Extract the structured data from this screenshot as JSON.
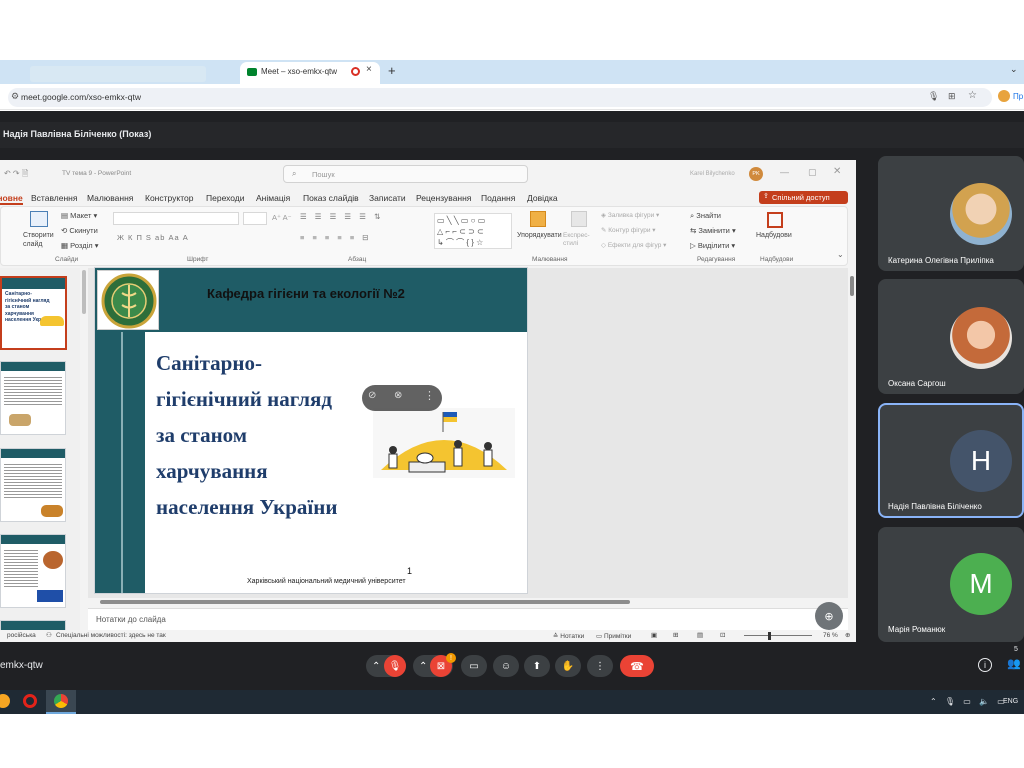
{
  "browser": {
    "tab_title": "Meet – xso-emkx-qtw",
    "url": "meet.google.com/xso-emkx-qtw",
    "profile_label": "Пр"
  },
  "meet": {
    "presenter_banner": "Надія Павлівна Біліченко (Показ)",
    "meeting_code": "emkx-qtw",
    "participants_count": "5",
    "mic_badge": "!"
  },
  "powerpoint": {
    "title": "ТV тема 9 - PowerPoint",
    "search_placeholder": "Пошук",
    "user_name": "Karel Bilychenko",
    "user_initials": "PK",
    "share_button": "Спільний доступ",
    "tabs": [
      "Основне",
      "Вставлення",
      "Малювання",
      "Конструктор",
      "Переходи",
      "Анімація",
      "Показ слайдів",
      "Записати",
      "Рецензування",
      "Подання",
      "Довідка"
    ],
    "ribbon": {
      "create_slide": "Створити слайд",
      "layout": "Макет",
      "reset": "Скинути",
      "section": "Розділ",
      "arrange": "Упорядкувати",
      "quick_styles": "Експрес-стилі",
      "shape_fill": "Заливка фігури",
      "shape_outline": "Контур фігури",
      "shape_effects": "Ефекти для фігур",
      "find": "Знайти",
      "replace": "Замінити",
      "select": "Виділити",
      "addins": "Надбудови",
      "font_row": "Ж  К  П  S  ab  Аа  А",
      "groups": [
        "Слайди",
        "Шрифт",
        "Абзац",
        "Малювання",
        "Редагування",
        "Надбудови"
      ]
    },
    "slide": {
      "header": "Кафедра гігієни та екології №2",
      "title_lines": [
        "Санітарно-",
        "гігієнічний нагляд",
        "за станом",
        "харчування",
        "населення України"
      ],
      "number": "1",
      "footer": "Харківський національний медичний університет"
    },
    "notes_placeholder": "Нотатки до слайда",
    "status": {
      "language": "російська",
      "accessibility": "Спеціальні можливості: здесь не так",
      "notes": "Нотатки",
      "comments": "Примітки",
      "zoom": "76 %"
    },
    "thumb1_lines": [
      "Санітарно-",
      "гігієнічний нагляд",
      "за станом",
      "харчування",
      "населення України"
    ]
  },
  "participants": [
    {
      "name": "Катерина Олегівна Приліпка",
      "type": "photo",
      "color": "#d9b98a"
    },
    {
      "name": "Оксана Саргош",
      "type": "photo",
      "color": "#c46a3a"
    },
    {
      "name": "Надія Павлівна Біліченко",
      "type": "initial",
      "initial": "Н",
      "color": "#44546a"
    },
    {
      "name": "Марія Романюк",
      "type": "initial",
      "initial": "М",
      "color": "#4caf50"
    }
  ],
  "taskbar": {
    "lang": "ENG"
  },
  "colors": {
    "teal": "#1f5c66",
    "slide_title": "#1f3d6b",
    "share_red": "#c43e1c",
    "end_call": "#ea4335",
    "active_tile_border": "#8ab4f8"
  }
}
